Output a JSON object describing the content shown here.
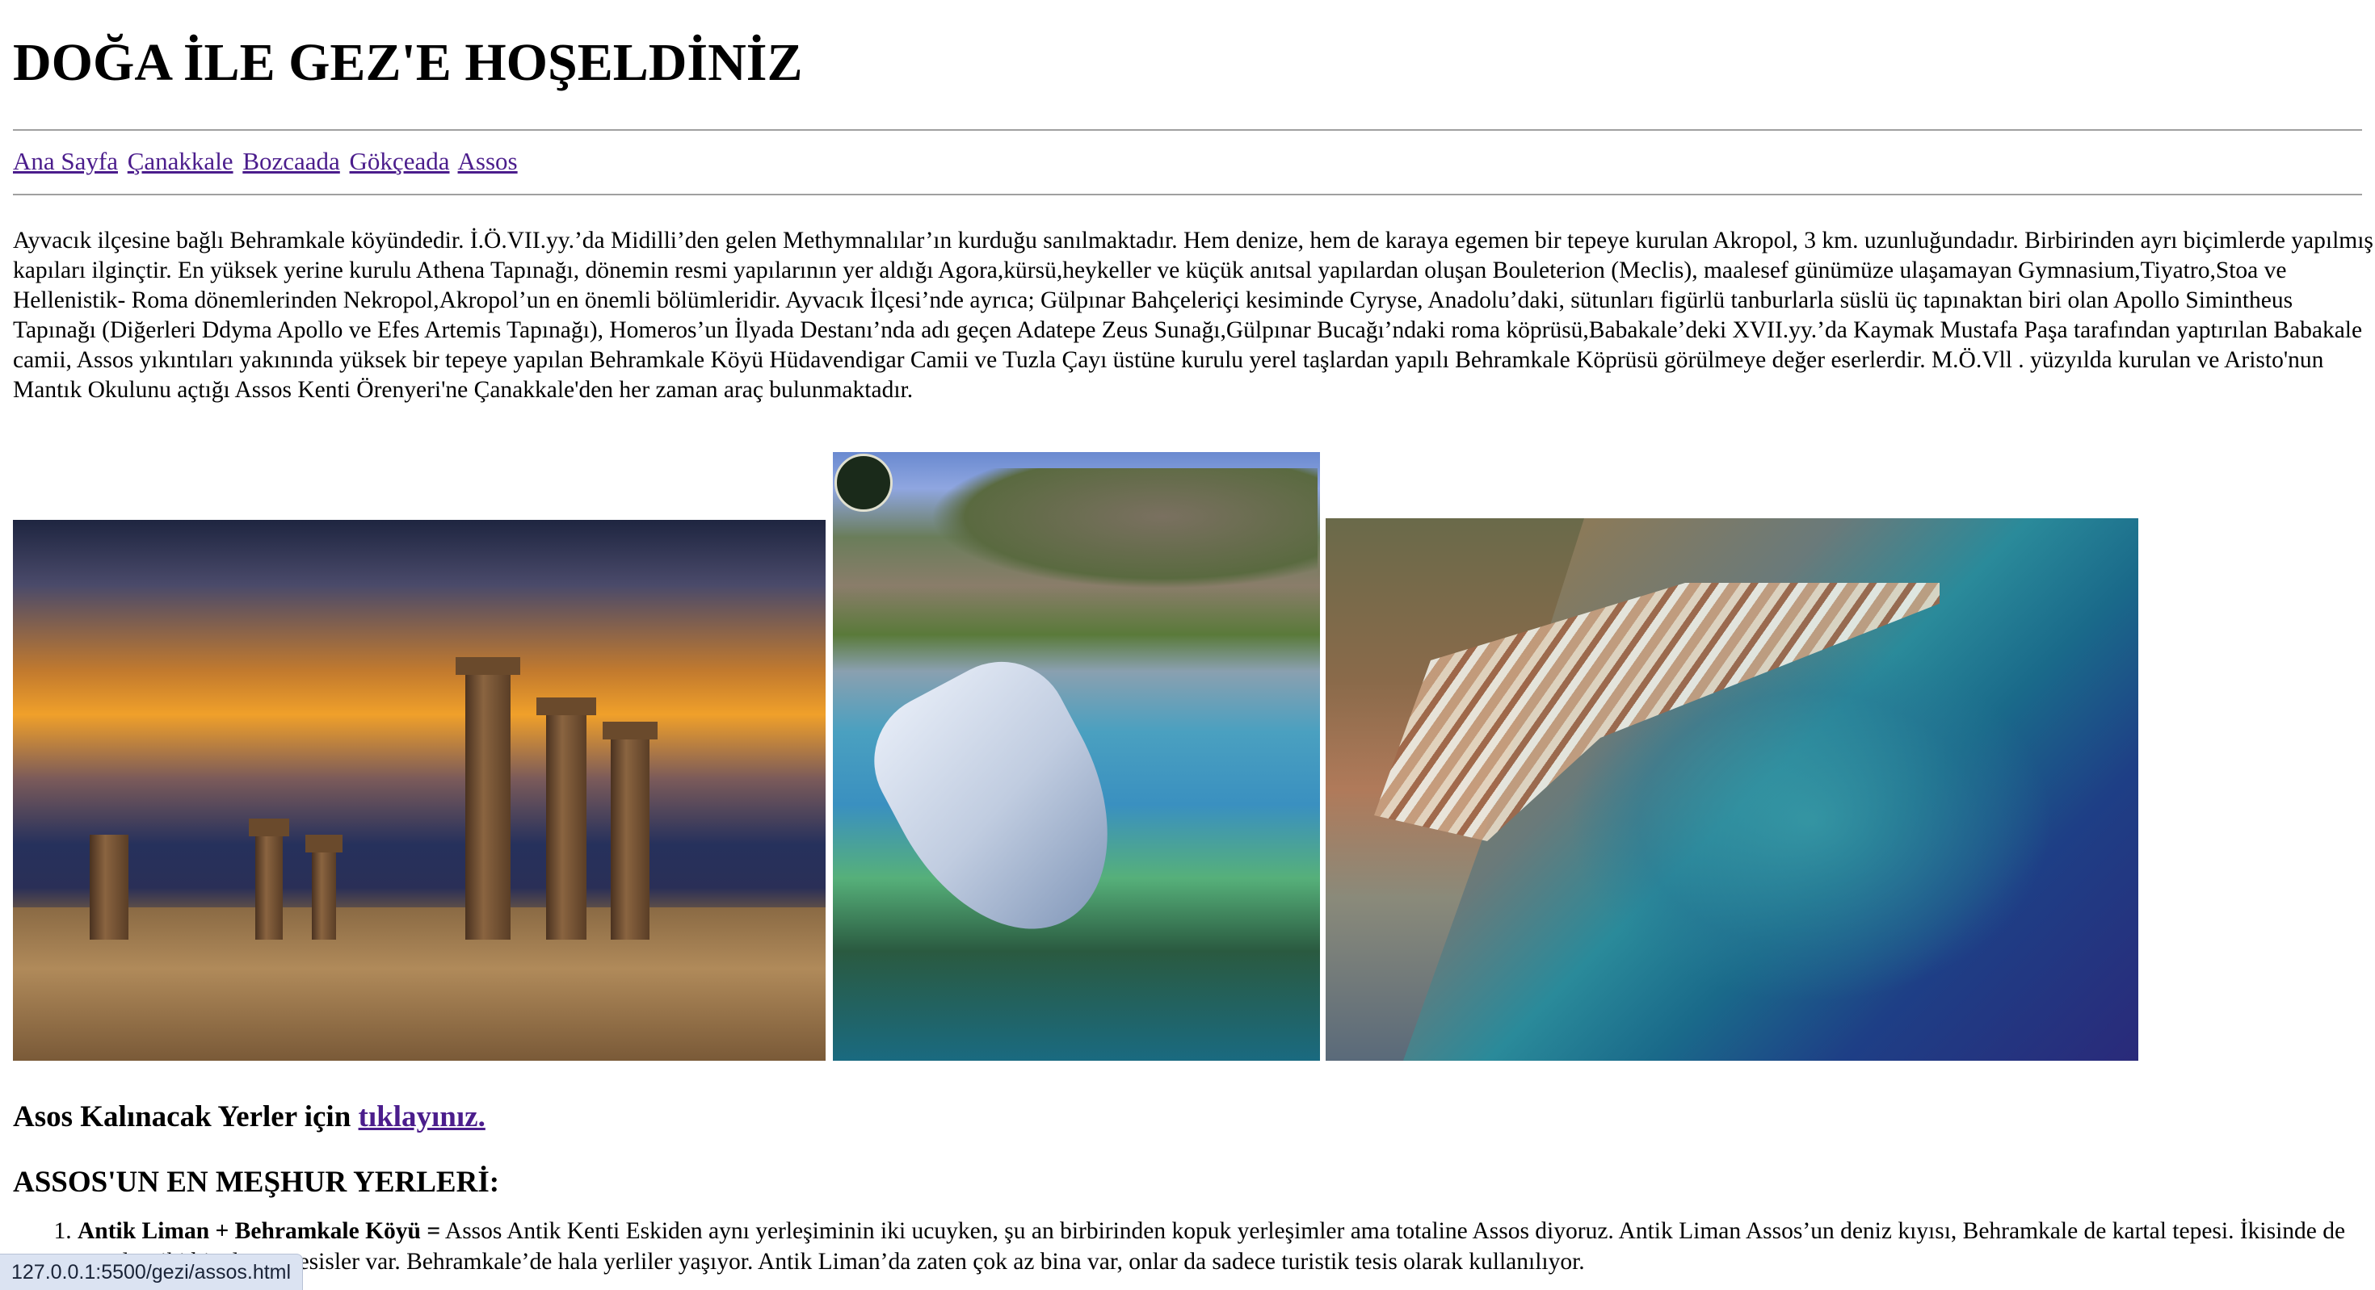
{
  "page": {
    "heading": "DOĞA İLE GEZ'E HOŞELDİNİZ"
  },
  "nav": {
    "items": [
      "Ana Sayfa",
      "Çanakkale",
      "Bozcaada",
      "Gökçeada",
      "Assos"
    ]
  },
  "intro": "Ayvacık ilçesine bağlı Behramkale köyündedir. İ.Ö.VII.yy.’da Midilli’den gelen Methymnalılar’ın kurduğu sanılmaktadır. Hem denize, hem de karaya egemen bir tepeye kurulan Akropol, 3 km. uzunluğundadır. Birbirinden ayrı biçimlerde yapılmış kapıları ilginçtir. En yüksek yerine kurulu Athena Tapınağı, dönemin resmi yapılarının yer aldığı Agora,kürsü,heykeller ve küçük anıtsal yapılardan oluşan Bouleterion (Meclis), maalesef günümüze ulaşamayan Gymnasium,Tiyatro,Stoa ve Hellenistik- Roma dönemlerinden Nekropol,Akropol’un en önemli bölümleridir. Ayvacık İlçesi’nde ayrıca; Gülpınar Bahçeleriçi kesiminde Cyryse, Anadolu’daki, sütunları figürlü tanburlarla süslü üç tapınaktan biri olan Apollo Simintheus Tapınağı (Diğerleri Ddyma Apollo ve Efes Artemis Tapınağı), Homeros’un İlyada Destanı’nda adı geçen Adatepe Zeus Sunağı,Gülpınar Bucağı’ndaki roma köprüsü,Babakale’deki XVII.yy.’da Kaymak Mustafa Paşa tarafından yaptırılan Babakale camii, Assos yıkıntıları yakınında yüksek bir tepeye yapılan Behramkale Köyü Hüdavendigar Camii ve Tuzla Çayı üstüne kurulu yerel taşlardan yapılı Behramkale Köprüsü görülmeye değer eserlerdir. M.Ö.Vll . yüzyılda kurulan ve Aristo'nun Mantık Okulunu açtığı Assos Kenti Örenyeri'ne Çanakkale'den her zaman araç bulunmaktadır.",
  "accommodation": {
    "text": "Asos Kalınacak Yerler için ",
    "link": "tıklayınız."
  },
  "famous": {
    "heading": "ASSOS'UN EN MEŞHUR YERLERİ:",
    "items": [
      {
        "title": "Antik Liman + Behramkale Köyü =",
        "text": " Assos Antik Kenti Eskiden aynı yerleşiminin iki ucuyken, şu an birbirinden kopuk yerleşimler ama totaline Assos diyoruz. Antik Liman Assos’un deniz kıyısı, Behramkale de kartal tepesi. İkisinde de güzel tarihi binalar ve tesisler var. Behramkale’de hala yerliler yaşıyor. Antik Liman’da zaten çok az bina var, onlar da sadece turistik tesis olarak kullanılıyor."
      }
    ]
  },
  "status": {
    "url": "127.0.0.1:5500/gezi/assos.html"
  },
  "colors": {
    "link": "#4b1d8c",
    "rule": "#a0a0a0",
    "statusbar": "#dbe3f2"
  }
}
